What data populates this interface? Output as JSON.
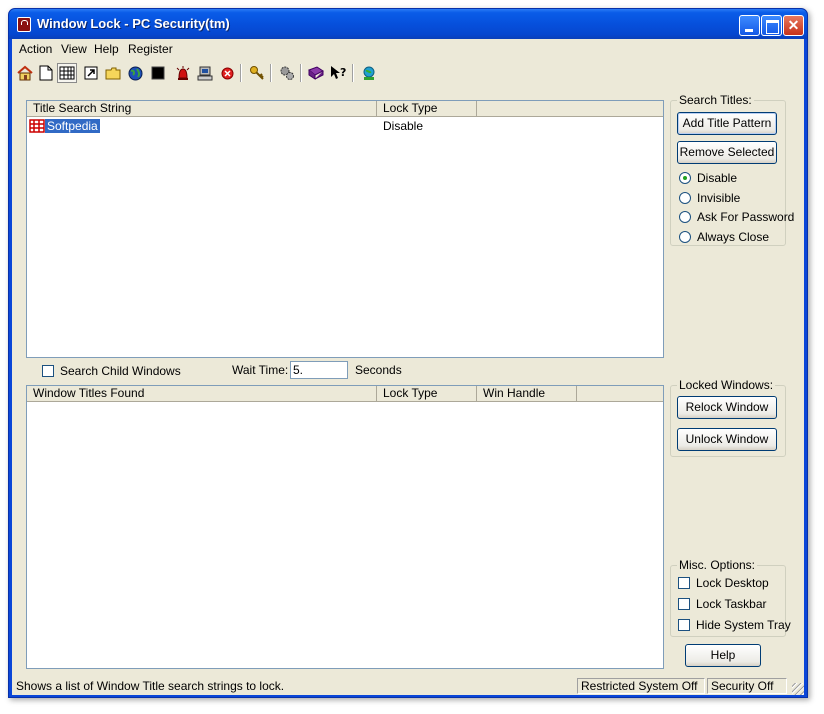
{
  "window": {
    "title": "Window Lock - PC Security(tm)",
    "minimize_label": "",
    "maximize_label": "",
    "close_label": "✕"
  },
  "menu": [
    "Action",
    "View",
    "Help",
    "Register"
  ],
  "toolbar": {
    "icons": [
      "home-icon",
      "new-document-icon",
      "calendar-icon",
      "shortcut-icon",
      "folder-icon",
      "globe-icon",
      "black-square-icon",
      "alarm-icon",
      "computer-icon",
      "stop-icon",
      "key-icon",
      "gears-icon",
      "book-icon",
      "whats-this-help-icon",
      "network-icon"
    ]
  },
  "search_list": {
    "columns": [
      "Title Search String",
      "Lock Type"
    ],
    "rows": [
      {
        "title": "Softpedia",
        "lock_type": "Disable"
      }
    ]
  },
  "search_titles": {
    "label": "Search Titles:",
    "add_button": "Add Title Pattern",
    "remove_button": "Remove Selected",
    "options": [
      "Disable",
      "Invisible",
      "Ask For Password",
      "Always Close"
    ],
    "selected": "Disable"
  },
  "search_child": {
    "label": "Search Child Windows",
    "checked": false
  },
  "wait_time": {
    "label": "Wait Time:",
    "value": "5.",
    "unit": "Seconds"
  },
  "found_list": {
    "columns": [
      "Window Titles Found",
      "Lock Type",
      "Win Handle"
    ],
    "rows": []
  },
  "locked_windows": {
    "label": "Locked Windows:",
    "relock_button": "Relock Window",
    "unlock_button": "Unlock Window"
  },
  "misc_options": {
    "label": "Misc. Options:",
    "options": [
      {
        "label": "Lock Desktop",
        "checked": false
      },
      {
        "label": "Lock Taskbar",
        "checked": false
      },
      {
        "label": "Hide System Tray",
        "checked": false
      }
    ]
  },
  "help_button": "Help",
  "status": {
    "message": "Shows a list of Window Title search strings to lock.",
    "restricted": "Restricted System Off",
    "security": "Security Off"
  },
  "colors": {
    "titlebar": "#0650dc",
    "selection": "#316ac5",
    "face": "#ece9d8"
  }
}
